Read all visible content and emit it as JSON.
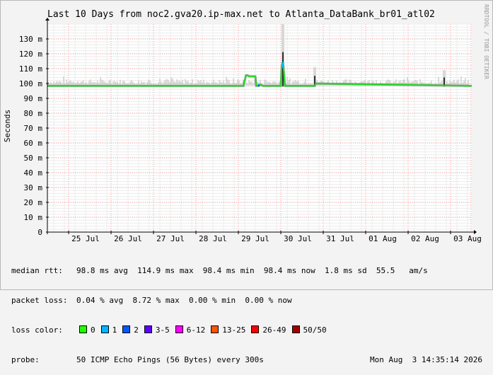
{
  "colors": {
    "median": "#22dd22",
    "grid": "#ff9999",
    "jitter": "#bdbdbd",
    "background": "#ffffff"
  },
  "chart_data": {
    "type": "line",
    "title": "Last 10 Days from noc2.gva20.ip-max.net to Atlanta_DataBank_br01_atl02",
    "ylabel": "Seconds",
    "xlabel": "",
    "side_label": "RRDTOOL / TOBI OETIKER",
    "ylim": [
      0,
      0.14
    ],
    "xlim_days": [
      0,
      10
    ],
    "yticks": [
      {
        "v": 0,
        "label": "0"
      },
      {
        "v": 0.01,
        "label": "10 m"
      },
      {
        "v": 0.02,
        "label": "20 m"
      },
      {
        "v": 0.03,
        "label": "30 m"
      },
      {
        "v": 0.04,
        "label": "40 m"
      },
      {
        "v": 0.05,
        "label": "50 m"
      },
      {
        "v": 0.06,
        "label": "60 m"
      },
      {
        "v": 0.07,
        "label": "70 m"
      },
      {
        "v": 0.08,
        "label": "80 m"
      },
      {
        "v": 0.09,
        "label": "90 m"
      },
      {
        "v": 0.1,
        "label": "100 m"
      },
      {
        "v": 0.11,
        "label": "110 m"
      },
      {
        "v": 0.12,
        "label": "120 m"
      },
      {
        "v": 0.13,
        "label": "130 m"
      }
    ],
    "xticks": [
      {
        "x": 0.9,
        "label": "25 Jul"
      },
      {
        "x": 1.9,
        "label": "26 Jul"
      },
      {
        "x": 2.9,
        "label": "27 Jul"
      },
      {
        "x": 3.9,
        "label": "28 Jul"
      },
      {
        "x": 4.9,
        "label": "29 Jul"
      },
      {
        "x": 5.9,
        "label": "30 Jul"
      },
      {
        "x": 6.9,
        "label": "31 Jul"
      },
      {
        "x": 7.9,
        "label": "01 Aug"
      },
      {
        "x": 8.9,
        "label": "02 Aug"
      },
      {
        "x": 9.9,
        "label": "03 Aug"
      }
    ],
    "series": [
      {
        "name": "median rtt",
        "x": [
          0,
          4.62,
          4.63,
          4.65,
          4.68,
          4.72,
          4.75,
          4.9,
          4.92,
          4.98,
          5.02,
          5.08,
          5.12,
          5.4,
          5.5,
          5.52,
          5.54,
          5.56,
          5.58,
          5.6,
          5.65,
          6.3,
          6.32,
          10
        ],
        "y": [
          0.0984,
          0.0984,
          0.1005,
          0.102,
          0.1055,
          0.1055,
          0.1048,
          0.1048,
          0.0984,
          0.0984,
          0.0992,
          0.0984,
          0.0984,
          0.0984,
          0.0984,
          0.111,
          0.1145,
          0.112,
          0.1045,
          0.0984,
          0.0984,
          0.0984,
          0.1,
          0.0984
        ]
      }
    ],
    "jitter_spikes": [
      {
        "x": 5.55,
        "top": 0.14,
        "bottom": 0.098
      },
      {
        "x": 6.3,
        "top": 0.111,
        "bottom": 0.098
      },
      {
        "x": 9.35,
        "top": 0.109,
        "bottom": 0.098
      }
    ]
  },
  "stats": {
    "median_label": "median rtt:",
    "median_text": "98.8 ms avg  114.9 ms max  98.4 ms min  98.4 ms now  1.8 ms sd  55.5   am/s",
    "loss_label": "packet loss:",
    "loss_text": "0.04 % avg  8.72 % max  0.00 % min  0.00 % now",
    "color_label": "loss color:",
    "legend": [
      {
        "label": "0",
        "color": "#26ff00"
      },
      {
        "label": "1",
        "color": "#00b8ff"
      },
      {
        "label": "2",
        "color": "#0059ff"
      },
      {
        "label": "3-5",
        "color": "#5e00ff"
      },
      {
        "label": "6-12",
        "color": "#ff00ff"
      },
      {
        "label": "13-25",
        "color": "#ff5500"
      },
      {
        "label": "26-49",
        "color": "#ff0000"
      },
      {
        "label": "50/50",
        "color": "#a10000"
      }
    ],
    "probe_label": "probe:",
    "probe_text": "50 ICMP Echo Pings (56 Bytes) every 300s",
    "date_text": "Mon Aug  3 14:35:14 2026"
  }
}
